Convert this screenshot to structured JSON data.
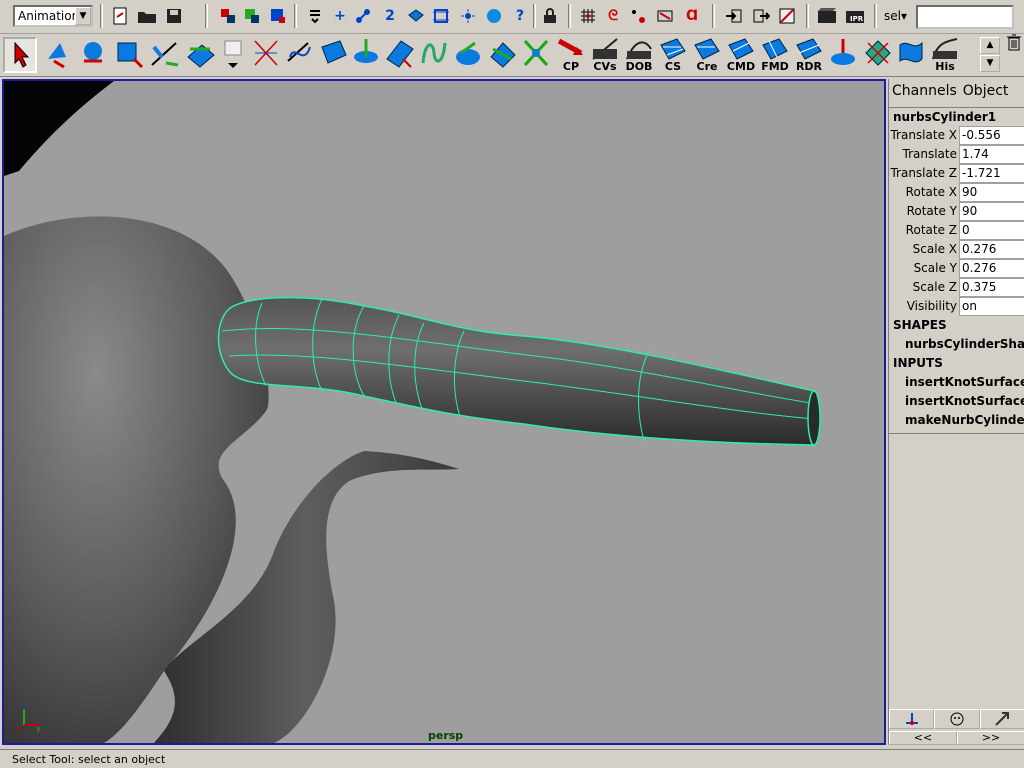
{
  "status_line": {
    "mode": "Animation",
    "select_label": "sel",
    "select_value": ""
  },
  "shelf": {
    "labels": [
      "CP",
      "CVs",
      "DOB",
      "CS",
      "Cre",
      "CMD",
      "FMD",
      "RDR",
      "His"
    ]
  },
  "viewport": {
    "camera_label": "persp",
    "wire_color": "#2bf0a0"
  },
  "channel_box": {
    "tabs": [
      "Channels",
      "Object"
    ],
    "object_name": "nurbsCylinder1",
    "attributes": [
      {
        "name": "Translate X",
        "value": "-0.556"
      },
      {
        "name": "Translate",
        "value": "1.74"
      },
      {
        "name": "Translate Z",
        "value": "-1.721"
      },
      {
        "name": "Rotate X",
        "value": "90"
      },
      {
        "name": "Rotate Y",
        "value": "90"
      },
      {
        "name": "Rotate Z",
        "value": "0"
      },
      {
        "name": "Scale X",
        "value": "0.276"
      },
      {
        "name": "Scale Y",
        "value": "0.276"
      },
      {
        "name": "Scale Z",
        "value": "0.375"
      },
      {
        "name": "Visibility",
        "value": "on"
      }
    ],
    "shapes_header": "SHAPES",
    "shapes": [
      "nurbsCylinderSha"
    ],
    "inputs_header": "INPUTS",
    "inputs": [
      "insertKnotSurface",
      "insertKnotSurface",
      "makeNurbCylinder"
    ],
    "nav": [
      "<<",
      ">>"
    ]
  },
  "help_line": "Select Tool: select an object"
}
